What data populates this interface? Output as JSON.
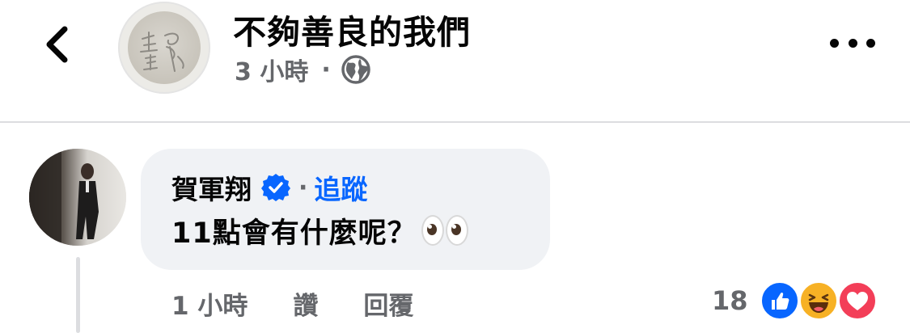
{
  "header": {
    "page_title": "不夠善良的我們",
    "post_time": "3 小時",
    "separator": "·",
    "audience_icon": "globe-icon",
    "avatar_text": "生 良 善"
  },
  "comment": {
    "author": "賀軍翔",
    "verified_icon": "verified-badge-icon",
    "separator": "·",
    "follow_label": "追蹤",
    "text": "11點會有什麼呢？",
    "emoji": "eyes-emoji"
  },
  "actions": {
    "time": "1 小時",
    "like_label": "讚",
    "reply_label": "回覆"
  },
  "reactions": {
    "count": "18",
    "types": [
      "like",
      "haha",
      "love"
    ]
  },
  "colors": {
    "link_blue": "#0866ff",
    "secondary_text": "#65676b",
    "bubble_bg": "#f0f2f5",
    "love_red": "#f33e58",
    "haha_yellow": "#f7b125"
  }
}
